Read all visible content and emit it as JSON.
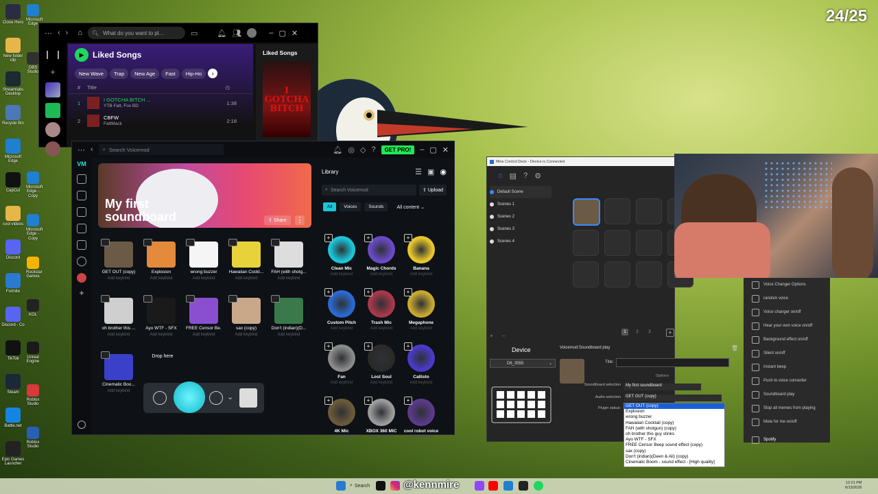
{
  "overlay": {
    "counter": "24/25"
  },
  "desktop_icons": [
    {
      "label": "Clone Hero",
      "color": "#2b2b44"
    },
    {
      "label": "New folder clip",
      "color": "#e6b64a"
    },
    {
      "label": "Streamlabs Desktop",
      "color": "#1b2a33"
    },
    {
      "label": "Recycle Bin",
      "color": "#4b78b6"
    },
    {
      "label": "Microsoft Edge",
      "color": "#1f7fd0"
    },
    {
      "label": "CapCut",
      "color": "#111111"
    },
    {
      "label": "cool videos",
      "color": "#e6b64a"
    },
    {
      "label": "Discord",
      "color": "#5865f2"
    },
    {
      "label": "Fortnite",
      "color": "#2a7bd0"
    },
    {
      "label": "Discord - Co",
      "color": "#5865f2"
    },
    {
      "label": "TikTok",
      "color": "#111111"
    },
    {
      "label": "Steam",
      "color": "#1b2838"
    },
    {
      "label": "Battle.net",
      "color": "#1486e2"
    },
    {
      "label": "Epic Games Launcher",
      "color": "#222222"
    }
  ],
  "desktop_icons_col2": [
    {
      "label": "Microsoft Edge",
      "color": "#1f7fd0"
    },
    {
      "label": "OBS Studio",
      "color": "#303030"
    },
    {
      "label": "Microsoft Edge - Copy",
      "color": "#1f7fd0"
    },
    {
      "label": "Microsoft Edge - Copy",
      "color": "#1f7fd0"
    },
    {
      "label": "Rockstar Games",
      "color": "#f5b400"
    },
    {
      "label": "KOL",
      "color": "#222222"
    },
    {
      "label": "Unreal Engine",
      "color": "#1a1a1a"
    },
    {
      "label": "Roblox Studio",
      "color": "#d63a3a"
    },
    {
      "label": "Roblox Studio",
      "color": "#2a5fb6"
    }
  ],
  "spotify": {
    "search_placeholder": "What do you want to pl...",
    "playlist_title": "Liked Songs",
    "chips": [
      "New Wave",
      "Trap",
      "New Age",
      "Fast",
      "Hip-Ho"
    ],
    "col_num": "#",
    "col_title": "Title",
    "tracks": [
      {
        "num": "1",
        "title": "I GOTCHA BITCH ...",
        "artist": "YTB Fatt, Fox BD",
        "duration": "1:38",
        "active": true
      },
      {
        "num": "2",
        "title": "CBFW",
        "artist": "FattMack",
        "duration": "2:18",
        "active": false
      }
    ],
    "side_title": "Liked Songs",
    "cover_text": "I GOTCHA BITCH"
  },
  "voicemod": {
    "search_placeholder": "Search Voicemod",
    "get_pro": "GET PRO!",
    "banner_title_1": "My first",
    "banner_title_2": "soundboard",
    "share": "Share",
    "drop_here": "Drop here",
    "add_keybind": "Add keybind",
    "sounds": [
      {
        "label": "GET OUT (copy)",
        "color": "#6b5a45"
      },
      {
        "label": "Explosion",
        "color": "#e48a3a"
      },
      {
        "label": "wrong buzzer",
        "color": "#f5f5f5"
      },
      {
        "label": "Hawaiian Cockt...",
        "color": "#e8d23a"
      },
      {
        "label": "FAH (with shotg...",
        "color": "#dddddd"
      },
      {
        "label": "oh brother this ...",
        "color": "#cfcfcf"
      },
      {
        "label": "Ayo WTF - SFX",
        "color": "#1a1a1a"
      },
      {
        "label": "FREE Censor Be...",
        "color": "#8a4fd0"
      },
      {
        "label": "sax (copy)",
        "color": "#c9a88a"
      },
      {
        "label": "Don't (indian)(D...",
        "color": "#3a7a4a"
      },
      {
        "label": "Cinematic Boo...",
        "color": "#3a40c8"
      }
    ],
    "library": {
      "title": "Library",
      "search_placeholder": "Search Voicemod",
      "upload": "Upload",
      "filters": [
        "All",
        "Voices",
        "Sounds"
      ],
      "content_filter": "All content",
      "items": [
        {
          "label": "Clean Mic",
          "color": "#19c6d8"
        },
        {
          "label": "Magic Chords",
          "color": "#6a4ac8"
        },
        {
          "label": "Banana",
          "color": "#e8c62a"
        },
        {
          "label": "Custom Pitch",
          "color": "#2a6ad0"
        },
        {
          "label": "Trash Mic",
          "color": "#a8384a"
        },
        {
          "label": "Megaphone",
          "color": "#c8a830"
        },
        {
          "label": "Fan",
          "color": "#8a8a8a"
        },
        {
          "label": "Lost Soul",
          "color": "#2a2a2a"
        },
        {
          "label": "Callisto",
          "color": "#4a3ac8"
        },
        {
          "label": "4K Mic",
          "color": "#6a5a3a"
        },
        {
          "label": "XBOX 360 MIC",
          "color": "#9a9a9a"
        },
        {
          "label": "cool robot voice",
          "color": "#5a3a8a"
        }
      ]
    }
  },
  "fifine": {
    "title": "fifine Control Deck - Device is Connected",
    "scenes": [
      "Default Scene",
      "Scenes 1",
      "Scenes 2",
      "Scenes 3",
      "Scenes 4"
    ],
    "pages": [
      "1",
      "2",
      "3"
    ],
    "device_label": "Device",
    "device_value": "D6_3555",
    "action_title": "Voicemod:Soundboard play",
    "title_label": "Title:",
    "options_label": "Options",
    "soundboard_label": "Soundboard selection",
    "soundboard_value": "My first soundboard",
    "audio_label": "Audio selection",
    "audio_value": "GET OUT (copy)",
    "plugin_label": "Plugin status:",
    "dropdown_items": [
      "GET OUT (copy)",
      "Explosion",
      "wrong buzzer",
      "Hawaiian Cocktail (copy)",
      "FAH (with shotgun) (copy)",
      "oh brother this guy stinks",
      "Ayo WTF - SFX",
      "FREE Censor Beep sound effect (copy)",
      "sax (copy)",
      "Don't (indian)(Deen & Ali) (copy)",
      "Cinematic Boom - sound effect - [High quality]"
    ]
  },
  "plugins": [
    "Voice Changer Options",
    "random voice",
    "Voice changer on/off",
    "Hear your own voice on/off",
    "Background effect on/off",
    "Silent on/off",
    "Instant beep",
    "Push to voice converter",
    "Soundboard play",
    "Stop all memes from playing",
    "Mute for me on/off",
    "Spotify"
  ],
  "taskbar": {
    "search": "Search",
    "handle": "@kennmire",
    "time": "12:21 PM",
    "date": "6/13/2026"
  }
}
